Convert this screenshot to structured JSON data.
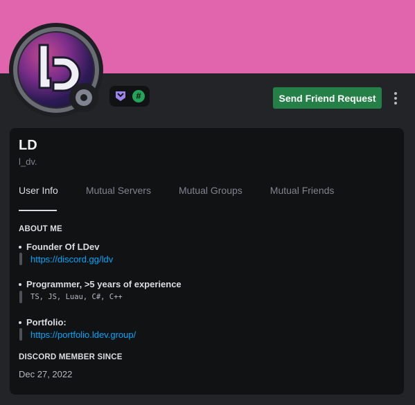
{
  "profile": {
    "display_name": "LD",
    "username": "l_dv.",
    "banner_color": "#e065ad",
    "status": "offline"
  },
  "badges": [
    {
      "name": "hypesquad-balance-icon",
      "color": "#9c84ec"
    },
    {
      "name": "active-developer-icon",
      "color": "#23a559",
      "glyph": "#"
    }
  ],
  "actions": {
    "send_friend_request": "Send Friend Request"
  },
  "tabs": [
    {
      "label": "User Info",
      "active": true
    },
    {
      "label": "Mutual Servers",
      "active": false
    },
    {
      "label": "Mutual Groups",
      "active": false
    },
    {
      "label": "Mutual Friends",
      "active": false
    }
  ],
  "about": {
    "title": "ABOUT ME",
    "items": [
      {
        "heading": "Founder Of LDev",
        "detail": "https://discord.gg/ldv",
        "detail_type": "link"
      },
      {
        "heading": "Programmer, >5 years of experience",
        "detail": "TS, JS, Luau, C#, C++",
        "detail_type": "code"
      },
      {
        "heading": "Portfolio:",
        "detail": "https://portfolio.ldev.group/",
        "detail_type": "link"
      }
    ]
  },
  "member_since": {
    "title": "DISCORD MEMBER SINCE",
    "date": "Dec 27, 2022"
  }
}
